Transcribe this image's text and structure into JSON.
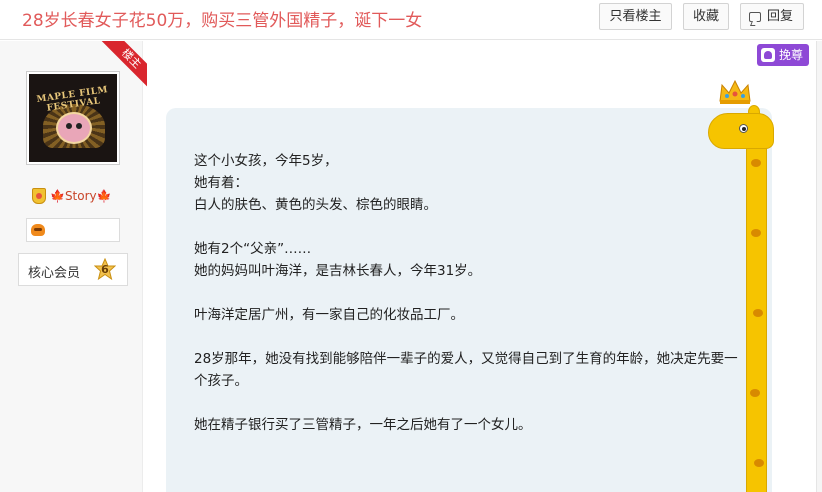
{
  "thread": {
    "title": "28岁长春女子花50万，购买三管外国精子，诞下一女"
  },
  "toolbar": {
    "only_op_label": "只看楼主",
    "favorite_label": "收藏",
    "reply_label": "回复"
  },
  "author": {
    "op_tag": "楼主",
    "avatar_text": "MAPLE FILM FESTIVAL",
    "username": "🍁Story🍁",
    "level_title": "核心会员",
    "level_number": "6"
  },
  "side_widget": {
    "vip_label": "挽尊"
  },
  "post": {
    "paragraphs": [
      [
        "这个小女孩，今年5岁，",
        "她有着：",
        "白人的肤色、黄色的头发、棕色的眼睛。"
      ],
      [
        "她有2个“父亲”……",
        "她的妈妈叫叶海洋，是吉林长春人，今年31岁。"
      ],
      [
        "叶海洋定居广州，有一家自己的化妆品工厂。"
      ],
      [
        "28岁那年，她没有找到能够陪伴一辈子的爱人，又觉得自己到了生育的年龄，她决定先要一个孩子。"
      ],
      [
        "她在精子银行买了三管精子，一年之后她有了一个女儿。"
      ]
    ]
  },
  "colors": {
    "title": "#e15a5a",
    "op_ribbon": "#d9262e",
    "content_bg": "#ebf2f6",
    "giraffe": "#f6c400",
    "vip": "#8e49d6"
  }
}
